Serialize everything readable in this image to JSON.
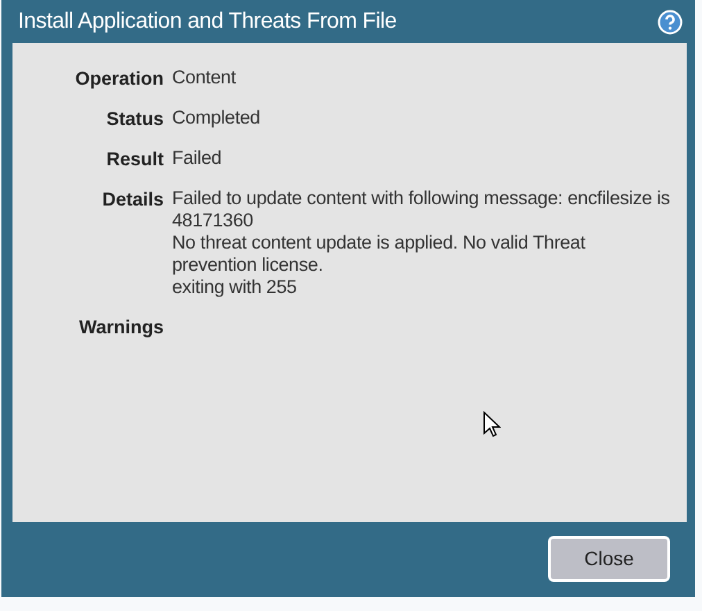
{
  "window": {
    "title": "Install Application and Threats From File"
  },
  "fields": [
    {
      "label": "Operation",
      "lines": [
        "Content"
      ]
    },
    {
      "label": "Status",
      "lines": [
        "Completed"
      ]
    },
    {
      "label": "Result",
      "lines": [
        "Failed"
      ]
    },
    {
      "label": "Details",
      "lines": [
        "Failed to update content with following message: encfilesize is 48171360",
        "No threat content update is applied. No valid Threat prevention license.",
        "exiting with 255"
      ]
    },
    {
      "label": "Warnings"
    }
  ],
  "buttons": [
    "Close"
  ]
}
